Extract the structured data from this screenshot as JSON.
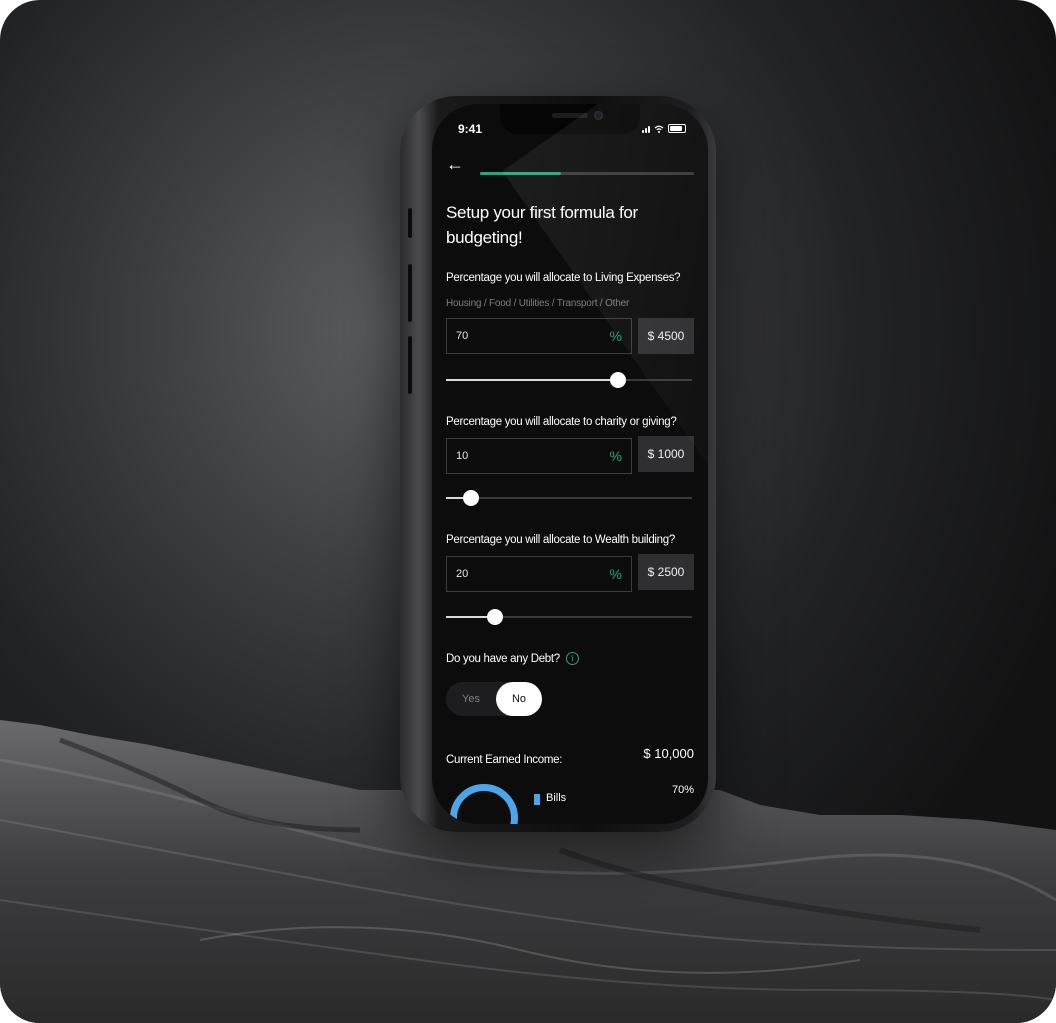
{
  "status_bar": {
    "time": "9:41"
  },
  "progress": {
    "fraction": 0.38
  },
  "screen_title": "Setup your first formula for budgeting!",
  "questions": [
    {
      "label": "Percentage you will allocate to Living Expenses?",
      "hint": "Housing / Food / Utilities / Transport / Other",
      "percent_value": "70",
      "percent_sign": "%",
      "amount": "$ 4500",
      "slider_level": 0.7
    },
    {
      "label": "Percentage you will allocate to charity or giving?",
      "percent_value": "10",
      "percent_sign": "%",
      "amount": "$ 1000",
      "slider_level": 0.1
    },
    {
      "label": "Percentage you will allocate to Wealth building?",
      "percent_value": "20",
      "percent_sign": "%",
      "amount": "$ 2500",
      "slider_level": 0.2
    }
  ],
  "debt": {
    "question": "Do you have any Debt?",
    "info_icon": "info-circle-icon",
    "options": [
      "Yes",
      "No"
    ],
    "selected": "No"
  },
  "income": {
    "label": "Current Earned Income:",
    "value": "$ 10,000"
  },
  "breakdown": {
    "legend_label": "Bills",
    "legend_percent": "70%"
  },
  "colors": {
    "accent_green": "#1ea97c",
    "chart_blue": "#4aa6e8",
    "screen_bg": "#0c0c0d"
  }
}
